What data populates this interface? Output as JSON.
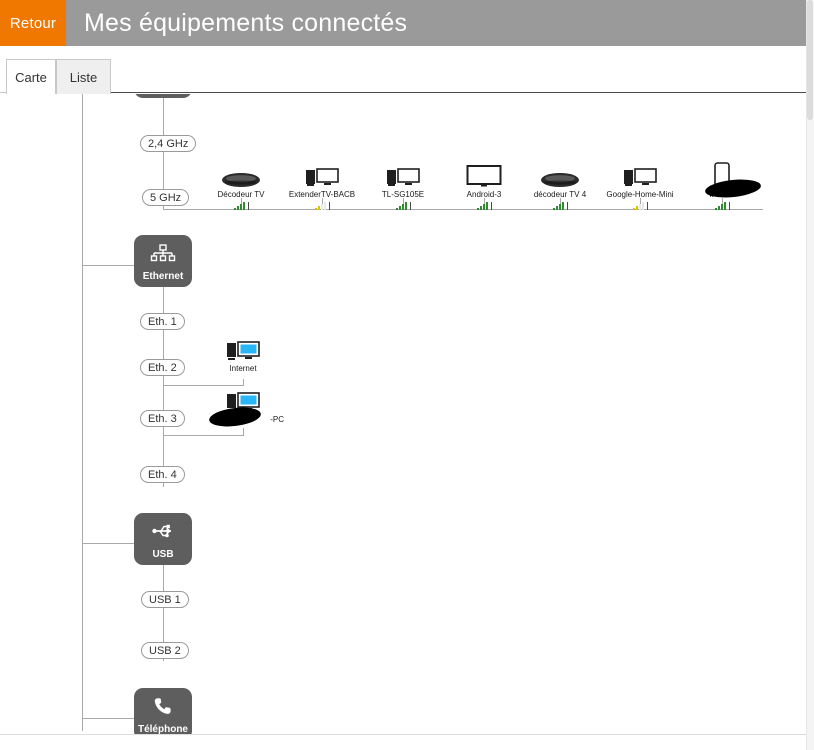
{
  "header": {
    "back_label": "Retour",
    "title": "Mes équipements connectés",
    "bar_color": "#9a9a9a",
    "accent_color": "#f07800"
  },
  "tabs": [
    {
      "label": "Carte",
      "active": true
    },
    {
      "label": "Liste",
      "active": false
    }
  ],
  "map": {
    "groups": [
      {
        "id": "wifi",
        "label": "",
        "icon": "wifi-box-icon",
        "clipped": true
      },
      {
        "id": "ethernet",
        "label": "Ethernet",
        "icon": "ethernet-icon"
      },
      {
        "id": "usb",
        "label": "USB",
        "icon": "usb-icon"
      },
      {
        "id": "telephone",
        "label": "Téléphone",
        "icon": "phone-handset-icon"
      }
    ],
    "wifi": {
      "bands": [
        {
          "label": "2,4 GHz"
        },
        {
          "label": "5 GHz"
        }
      ],
      "devices": [
        {
          "name": "Décodeur TV",
          "icon": "set-top-box-icon",
          "signal": "good",
          "signal_color": "#2e8b2e"
        },
        {
          "name": "ExtenderTV-BACB",
          "icon": "desktop-pc-icon",
          "signal": "weak",
          "signal_color": "#d8c300"
        },
        {
          "name": "TL-SG105E",
          "icon": "desktop-pc-icon",
          "signal": "good",
          "signal_color": "#2e8b2e"
        },
        {
          "name": "Android-3",
          "icon": "tv-screen-icon",
          "signal": "good",
          "signal_color": "#2e8b2e"
        },
        {
          "name": "décodeur TV 4",
          "icon": "set-top-box-icon",
          "signal": "good",
          "signal_color": "#2e8b2e"
        },
        {
          "name": "Google-Home-Mini",
          "icon": "desktop-pc-icon",
          "signal": "weak",
          "signal_color": "#d8c300"
        },
        {
          "name": "iPhone",
          "icon": "smartphone-icon",
          "signal": "good",
          "signal_color": "#2e8b2e",
          "redacted": true
        }
      ]
    },
    "ethernet": {
      "ports": [
        {
          "label": "Eth. 1",
          "device": null
        },
        {
          "label": "Eth. 2",
          "device": {
            "name": "Internet",
            "icon": "pc-monitor-blue-icon"
          }
        },
        {
          "label": "Eth. 3",
          "device": {
            "name": "-PC",
            "icon": "pc-monitor-blue-icon",
            "redacted": true
          }
        },
        {
          "label": "Eth. 4",
          "device": null
        }
      ]
    },
    "usb": {
      "ports": [
        {
          "label": "USB 1"
        },
        {
          "label": "USB 2"
        }
      ]
    }
  }
}
